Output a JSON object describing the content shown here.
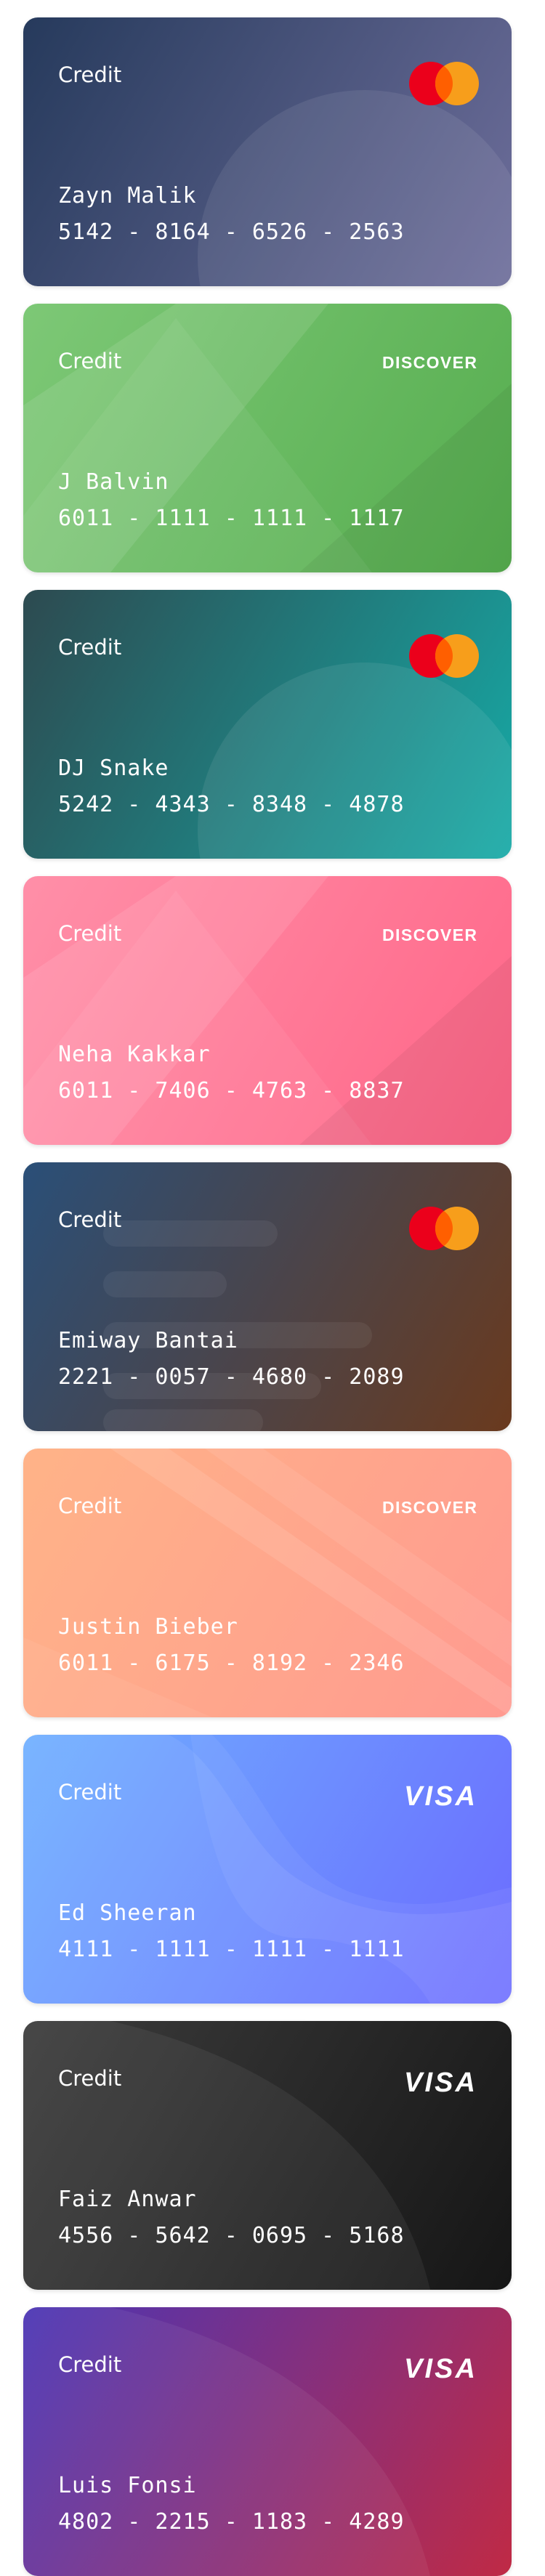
{
  "cards": [
    {
      "type": "Credit",
      "holder": "Zayn Malik",
      "number": "5142 - 8164 - 6526 - 2563",
      "network": "mastercard-icon",
      "bg": [
        "#263a5c",
        "#6e6e9b"
      ],
      "deco": "circle"
    },
    {
      "type": "Credit",
      "holder": "J Balvin",
      "number": "6011 - 1111 - 1111 - 1117",
      "network": "discover-logo",
      "network_text": "DISCOVER",
      "bg": [
        "#7dc876",
        "#56ad4f"
      ],
      "deco": "triangles"
    },
    {
      "type": "Credit",
      "holder": "DJ Snake",
      "number": "5242 - 4343 - 8348 - 4878",
      "network": "mastercard-icon",
      "bg": [
        "#2d4a50",
        "#16aaa6"
      ],
      "deco": "circle"
    },
    {
      "type": "Credit",
      "holder": "Neha Kakkar",
      "number": "6011 - 7406 - 4763 - 8837",
      "network": "discover-logo",
      "network_text": "DISCOVER",
      "bg": [
        "#ff8fa8",
        "#ff6688"
      ],
      "deco": "triangles"
    },
    {
      "type": "Credit",
      "holder": "Emiway Bantai",
      "number": "2221 - 0057 - 4680 - 2089",
      "network": "mastercard-icon",
      "bg": [
        "#2a4f78",
        "#6a3a1e"
      ],
      "deco": "bars"
    },
    {
      "type": "Credit",
      "holder": "Justin Bieber",
      "number": "6011 - 6175 - 8192 - 2346",
      "network": "discover-logo",
      "network_text": "DISCOVER",
      "bg": [
        "#ffb388",
        "#ff9a90"
      ],
      "deco": "diagonals"
    },
    {
      "type": "Credit",
      "holder": "Ed Sheeran",
      "number": "4111 - 1111 - 1111 - 1111",
      "network": "visa-logo",
      "network_text": "VISA",
      "bg": [
        "#6fb0ff",
        "#6b6bff"
      ],
      "deco": "wave"
    },
    {
      "type": "Credit",
      "holder": "Faiz Anwar",
      "number": "4556 - 5642 - 0695 - 5168",
      "network": "visa-logo",
      "network_text": "VISA",
      "bg": [
        "#3c3c3c",
        "#161616"
      ],
      "deco": "curve"
    },
    {
      "type": "Credit",
      "holder": "Luis Fonsi",
      "number": "4802 - 2215 - 1183 - 4289",
      "network": "visa-logo",
      "network_text": "VISA",
      "bg": [
        "#4a35b5",
        "#c02a45"
      ],
      "deco": "curve"
    }
  ]
}
